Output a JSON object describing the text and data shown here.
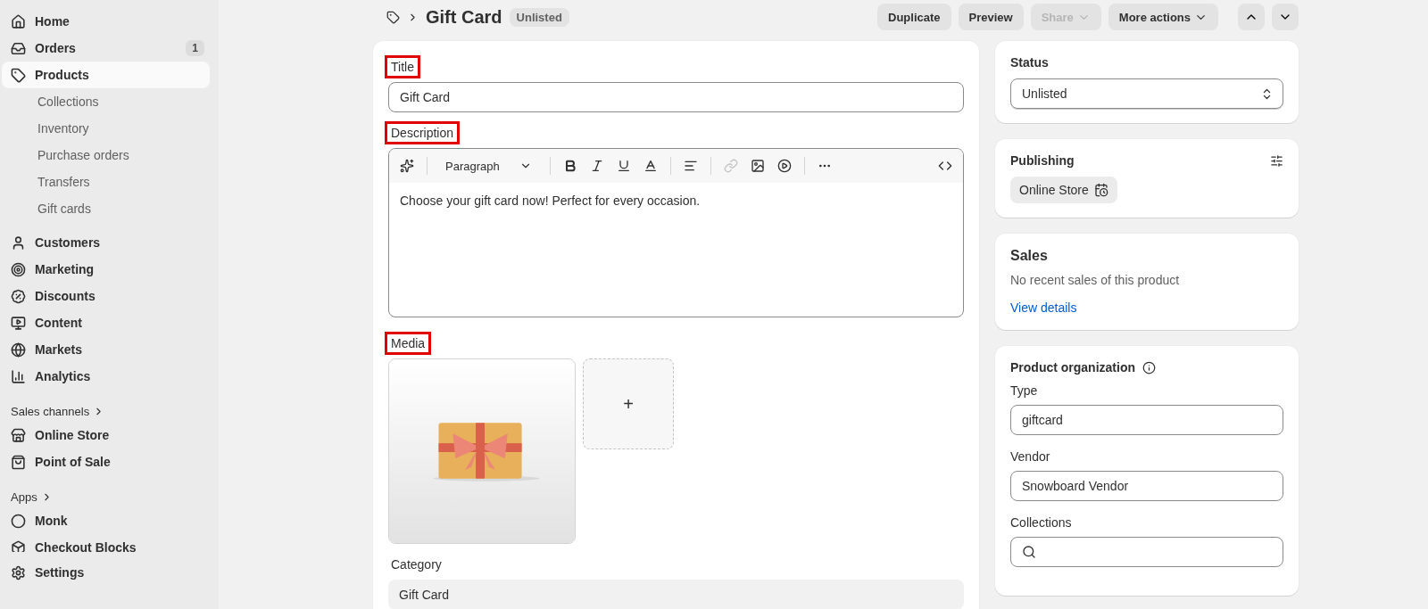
{
  "sidebar": {
    "main": [
      {
        "label": "Home",
        "selected": false
      },
      {
        "label": "Orders",
        "selected": false,
        "badge": "1"
      },
      {
        "label": "Products",
        "selected": true,
        "children": [
          {
            "label": "Collections",
            "selected": false
          },
          {
            "label": "Inventory",
            "selected": false
          },
          {
            "label": "Purchase orders",
            "selected": false
          },
          {
            "label": "Transfers",
            "selected": false
          },
          {
            "label": "Gift cards",
            "selected": false
          }
        ]
      },
      {
        "label": "Customers",
        "selected": false
      },
      {
        "label": "Marketing",
        "selected": false
      },
      {
        "label": "Discounts",
        "selected": false
      },
      {
        "label": "Content",
        "selected": false
      },
      {
        "label": "Markets",
        "selected": false
      },
      {
        "label": "Analytics",
        "selected": false
      }
    ],
    "sections": [
      {
        "heading": "Sales channels",
        "items": [
          {
            "label": "Online Store",
            "selected": false
          },
          {
            "label": "Point of Sale",
            "selected": false
          }
        ]
      },
      {
        "heading": "Apps",
        "items": [
          {
            "label": "Monk",
            "selected": false
          },
          {
            "label": "Checkout Blocks",
            "selected": false
          }
        ]
      }
    ],
    "footer": {
      "label": "Settings",
      "selected": false
    }
  },
  "header": {
    "title": "Gift Card",
    "badge": "Unlisted",
    "buttons": [
      {
        "label": "Duplicate",
        "disabled": false,
        "dropdown": false
      },
      {
        "label": "Preview",
        "disabled": false,
        "dropdown": false
      },
      {
        "label": "Share",
        "disabled": true,
        "dropdown": true
      },
      {
        "label": "More actions",
        "disabled": false,
        "dropdown": true
      }
    ]
  },
  "product": {
    "title": {
      "label": "Title",
      "highlighted": true,
      "value": "Gift Card"
    },
    "description": {
      "label": "Description",
      "highlighted": true,
      "style": "Paragraph",
      "link_disabled": true,
      "text": "Choose your gift card now! Perfect for every occasion."
    },
    "media": {
      "label": "Media",
      "highlighted": true,
      "add": "+"
    },
    "category": {
      "label": "Category",
      "highlighted": false,
      "value": "Gift Card"
    }
  },
  "status": {
    "heading": "Status",
    "value": "Unlisted"
  },
  "publishing": {
    "heading": "Publishing",
    "channels": [
      "Online Store"
    ]
  },
  "sales": {
    "heading": "Sales",
    "text": "No recent sales of this product",
    "link": "View details"
  },
  "organization": {
    "heading": "Product organization",
    "fields": [
      {
        "label": "Type",
        "value": "giftcard",
        "kind": "text"
      },
      {
        "label": "Vendor",
        "value": "Snowboard Vendor",
        "kind": "text"
      },
      {
        "label": "Collections",
        "kind": "search"
      }
    ]
  }
}
